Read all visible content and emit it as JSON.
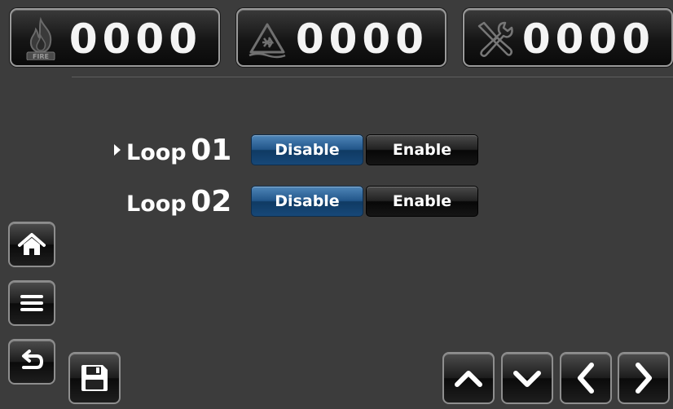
{
  "counters": {
    "fire": {
      "value": "0000",
      "icon": "fire-icon"
    },
    "fault": {
      "value": "0000",
      "icon": "fault-icon"
    },
    "service": {
      "value": "0000",
      "icon": "tools-icon"
    }
  },
  "fire_badge_text": "FIRE",
  "loops": [
    {
      "label": "Loop",
      "number": "01",
      "selected": true,
      "disable_label": "Disable",
      "enable_label": "Enable"
    },
    {
      "label": "Loop",
      "number": "02",
      "selected": false,
      "disable_label": "Disable",
      "enable_label": "Enable"
    }
  ],
  "side_buttons": [
    "home-icon",
    "menu-icon",
    "back-icon"
  ],
  "nav_buttons": [
    "chevron-up-icon",
    "chevron-down-icon",
    "chevron-left-icon",
    "chevron-right-icon"
  ],
  "colors": {
    "background": "#3c3c3c",
    "disable_button": "#22568a",
    "enable_button": "#0a0a0a"
  }
}
